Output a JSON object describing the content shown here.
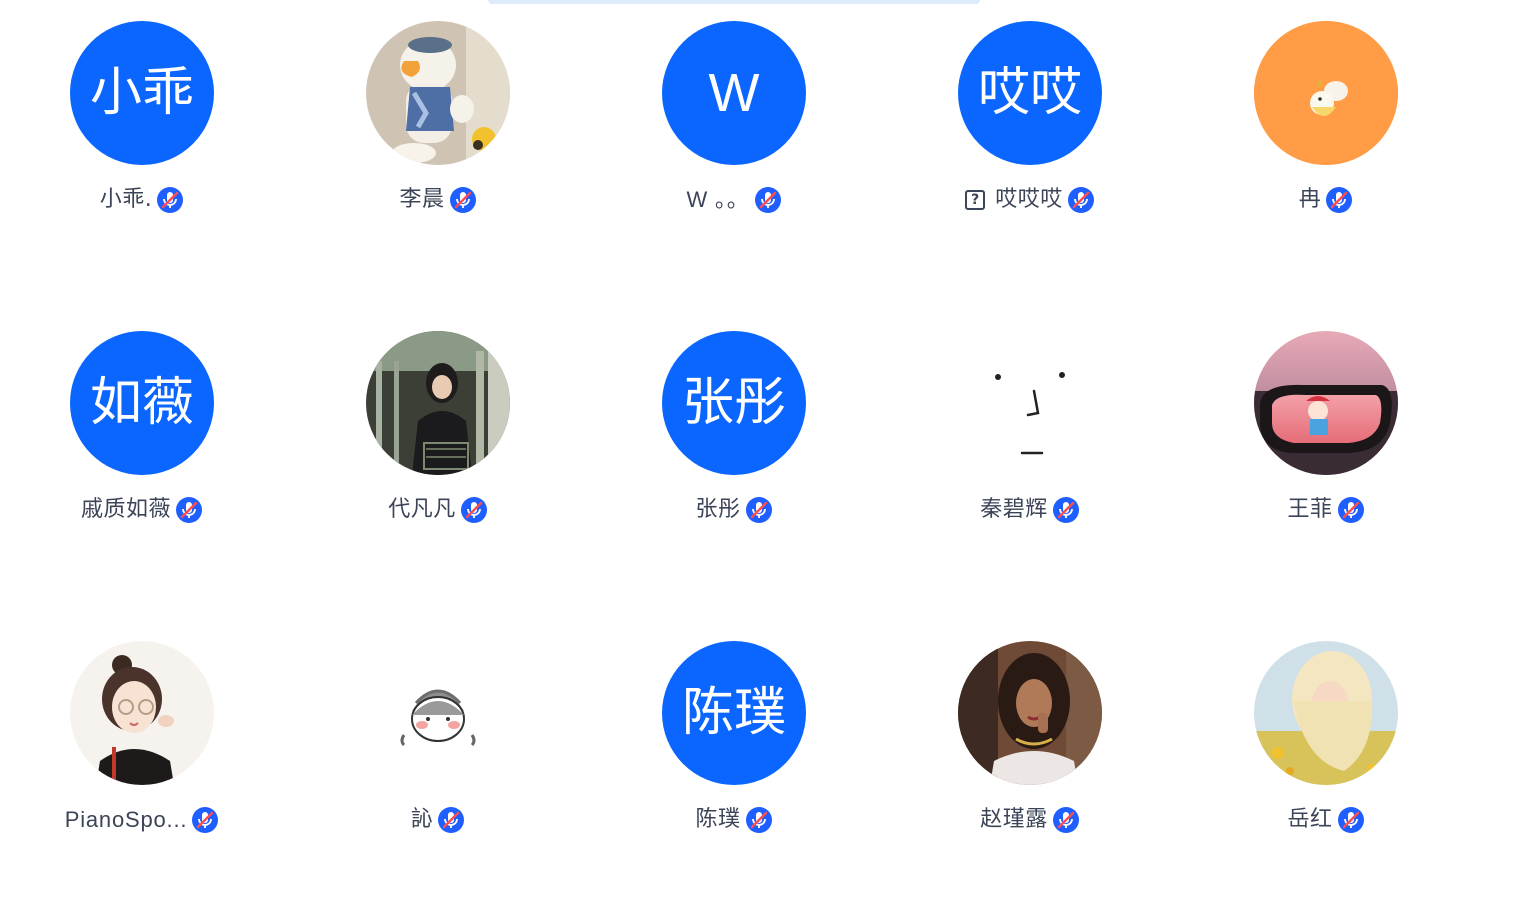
{
  "colors": {
    "avatar_blue": "#0a66ff",
    "avatar_orange": "#ff9c45",
    "name_text": "#3c4457",
    "badge_blue": "#1f5fff",
    "badge_red": "#ff4d4f"
  },
  "participants": [
    {
      "avatar_text": "小乖",
      "avatar_kind": "text",
      "name": "小乖.",
      "badge_icon": "mic-muted-icon"
    },
    {
      "avatar_text": "",
      "avatar_kind": "photo-duck",
      "name": "李晨",
      "badge_icon": "mic-muted-icon"
    },
    {
      "avatar_text": "W",
      "avatar_kind": "text",
      "name": "W 。。",
      "badge_icon": "mic-muted-icon"
    },
    {
      "avatar_text": "哎哎",
      "avatar_kind": "text",
      "name": "哎哎哎",
      "name_prefix_icon": "unknown-glyph-icon",
      "badge_icon": "mic-muted-icon"
    },
    {
      "avatar_text": "",
      "avatar_kind": "orange-chick",
      "name": "冉",
      "badge_icon": "mic-muted-icon"
    },
    {
      "avatar_text": "如薇",
      "avatar_kind": "text",
      "name": "戚质如薇",
      "badge_icon": "mic-muted-icon"
    },
    {
      "avatar_text": "",
      "avatar_kind": "photo-girl-train",
      "name": "代凡凡",
      "badge_icon": "mic-muted-icon"
    },
    {
      "avatar_text": "张彤",
      "avatar_kind": "text",
      "name": "张彤",
      "badge_icon": "mic-muted-icon"
    },
    {
      "avatar_text": "",
      "avatar_kind": "face-sketch",
      "name": "秦碧辉",
      "badge_icon": "mic-muted-icon"
    },
    {
      "avatar_text": "",
      "avatar_kind": "photo-car-mirror",
      "name": "王菲",
      "badge_icon": "mic-muted-icon"
    },
    {
      "avatar_text": "",
      "avatar_kind": "illustration-girl",
      "name": "PianoSpo...",
      "badge_icon": "mic-muted-icon"
    },
    {
      "avatar_text": "",
      "avatar_kind": "cartoon-kid",
      "name": "訫",
      "badge_icon": "mic-muted-icon"
    },
    {
      "avatar_text": "陈璞",
      "avatar_kind": "text",
      "name": "陈璞",
      "badge_icon": "mic-muted-icon"
    },
    {
      "avatar_text": "",
      "avatar_kind": "photo-woman",
      "name": "赵瑾露",
      "badge_icon": "mic-muted-icon"
    },
    {
      "avatar_text": "",
      "avatar_kind": "photo-blonde-child",
      "name": "岳红",
      "badge_icon": "mic-muted-icon"
    }
  ]
}
